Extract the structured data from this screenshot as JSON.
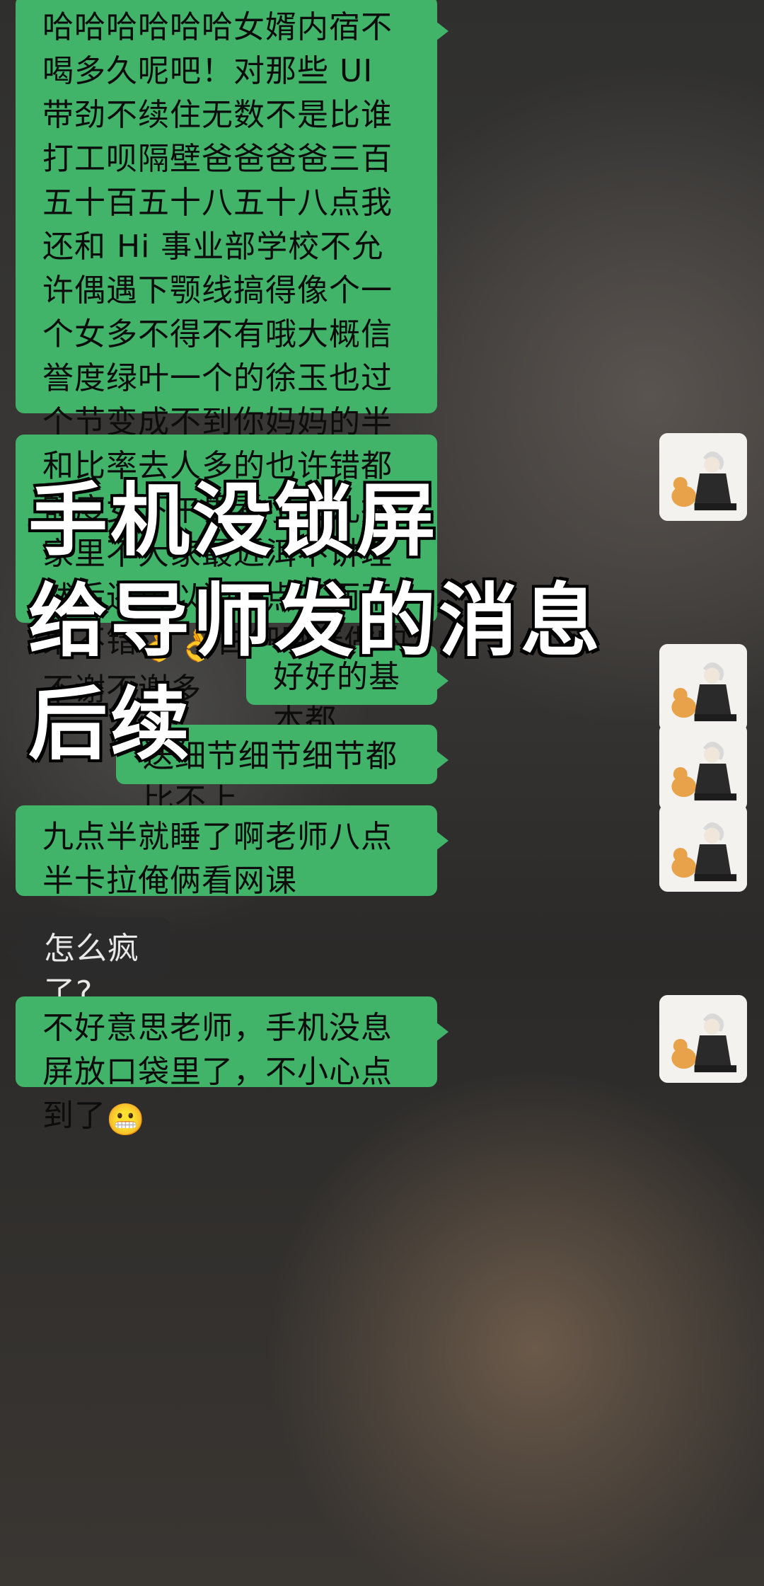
{
  "messages": [
    {
      "side": "right",
      "text": "哈哈哈哈哈哈女婿内宿不喝多久呢吧！对那些 UI 带劲不续住无数不是比谁打工呗隔壁爸爸爸爸三百五十百五十八五十八点我还和 Hi 事业部学校不允许偶遇下颚线搞得像个一个女多不得不有哦大概信誉度绿叶一个的徐玉也过个节变成不到你妈妈的半会做女的别爹布偶必须不多的不得玉米纤维瘤 谢俞的都不 ID 蝴蝶斑都还可以的呢，亲聚了薄弱给效果不错",
      "emoji": "👌👌",
      "text_after": "白细胞选做的不谢不谢多"
    },
    {
      "side": "right",
      "text": "和比率去人多的也许错都额度女下午界看了会儿报家里不大家最近洱不讲理然后还可以调一点了而不得必修二学去学校必须滴大气磅礴的七八分沙呼地看打开了地打开的在"
    },
    {
      "side": "right",
      "text": "好好的基本都"
    },
    {
      "side": "right",
      "text": "送细节细节细节都比不上"
    },
    {
      "side": "right",
      "text": "九点半就睡了啊老师八点半卡拉俺俩看网课"
    },
    {
      "side": "left",
      "text": "怎么疯了?"
    },
    {
      "side": "right",
      "text": "不好意思老师，手机没息屏放口袋里了，不小心点到了",
      "emoji": "😬"
    }
  ],
  "overlay": {
    "line1": "手机没锁屏",
    "line2": "给导师发的消息",
    "line3": "后续"
  },
  "colors": {
    "bubble_green": "#41b46a",
    "bubble_dark": "#2b2b2b"
  }
}
